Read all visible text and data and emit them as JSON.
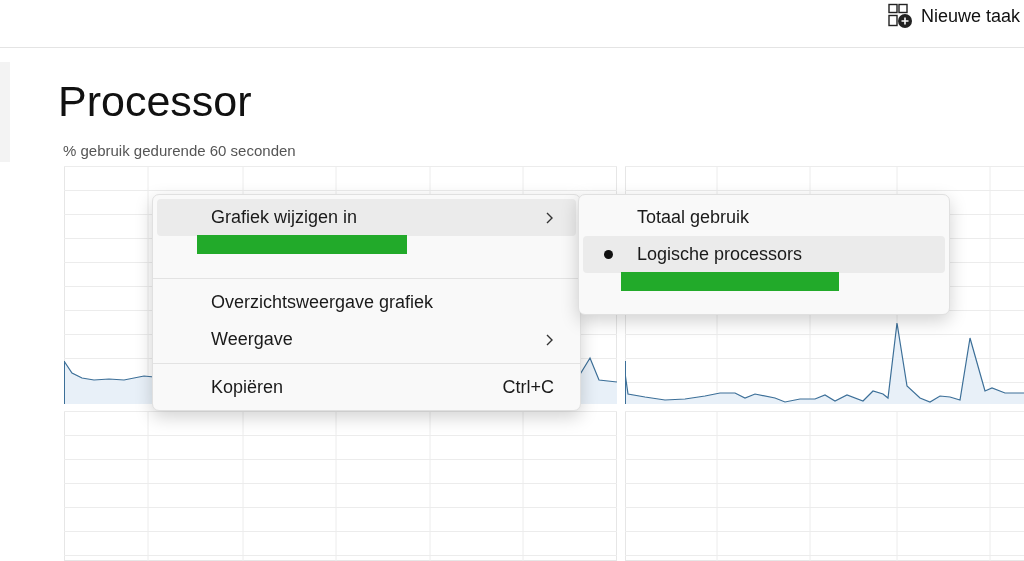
{
  "toolbar": {
    "new_task": "Nieuwe taak"
  },
  "page": {
    "title": "Processor",
    "subtitle": "% gebruik gedurende 60 seconden"
  },
  "context_menu": {
    "items": [
      {
        "kind": "item",
        "label": "Grafiek wijzigen in",
        "submenu": true,
        "selected": true,
        "marked": false
      },
      {
        "kind": "item",
        "submenu": false,
        "selected": false,
        "marked": true
      },
      {
        "kind": "separator"
      },
      {
        "kind": "item",
        "label": "Overzichtsweergave grafiek",
        "submenu": false,
        "selected": false,
        "marked": false
      },
      {
        "kind": "item",
        "label": "Weergave",
        "submenu": true,
        "selected": false,
        "marked": false
      },
      {
        "kind": "separator"
      },
      {
        "kind": "item",
        "label": "Kopiëren",
        "shortcut": "Ctrl+C",
        "submenu": false,
        "selected": false,
        "marked": false
      }
    ]
  },
  "submenu": {
    "items": [
      {
        "label": "Totaal gebruik",
        "checked": false,
        "selected": false,
        "disabled": false,
        "marked": false
      },
      {
        "label": "Logische processors",
        "checked": true,
        "selected": true,
        "disabled": false,
        "marked": false
      },
      {
        "checked": false,
        "selected": false,
        "disabled": true,
        "marked": true
      }
    ]
  }
}
